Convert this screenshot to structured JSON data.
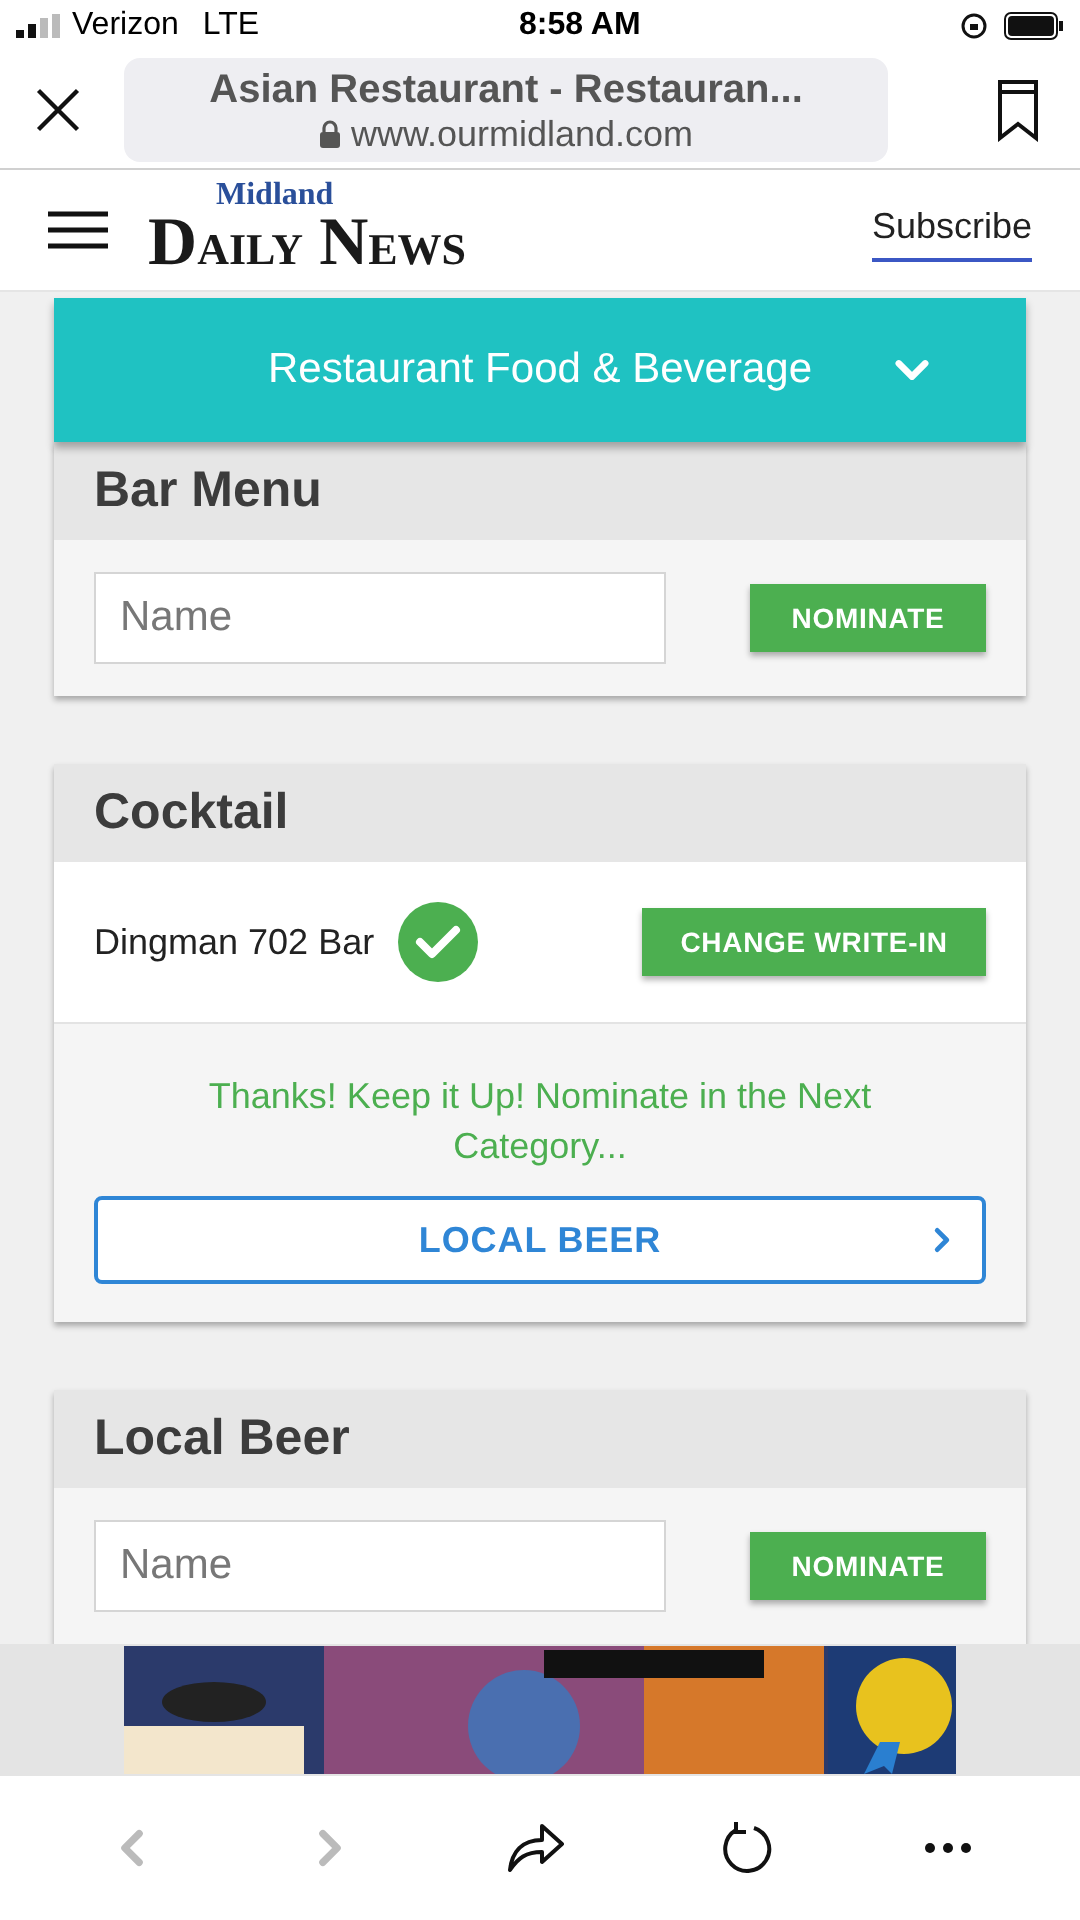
{
  "status_bar": {
    "carrier": "Verizon",
    "network": "LTE",
    "time": "8:58 AM"
  },
  "browser": {
    "title": "Asian Restaurant - Restauran...",
    "url": "www.ourmidland.com"
  },
  "site_header": {
    "logo_top": "Midland",
    "logo_words": [
      "DAILY",
      "NEWS"
    ],
    "subscribe": "Subscribe"
  },
  "group_bar": {
    "label": "Restaurant Food & Beverage",
    "expanded": false
  },
  "categories": [
    {
      "kind": "nominate",
      "title": "Bar Menu",
      "placeholder": "Name",
      "button": "NOMINATE"
    },
    {
      "kind": "written_in",
      "title": "Cocktail",
      "value": "Dingman 702 Bar",
      "button": "CHANGE WRITE-IN",
      "message": "Thanks! Keep it Up! Nominate in the Next Category...",
      "next": "LOCAL BEER"
    },
    {
      "kind": "nominate",
      "title": "Local Beer",
      "placeholder": "Name",
      "button": "NOMINATE"
    }
  ],
  "toolbar": {
    "back_disabled": true,
    "forward_disabled": true
  }
}
